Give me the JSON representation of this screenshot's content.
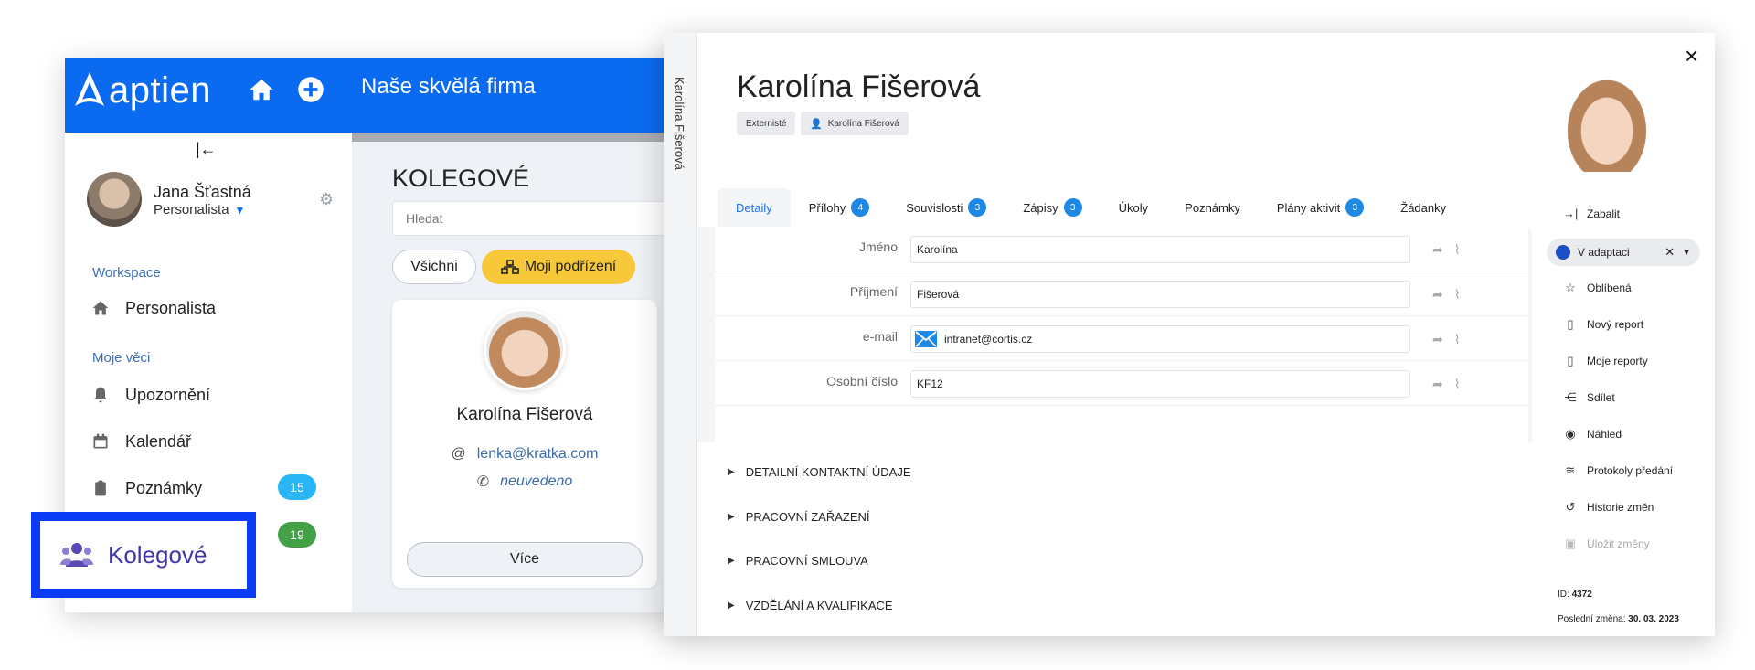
{
  "app": {
    "logo_text": "aptien",
    "company_name": "Naše skvělá firma",
    "brand_color": "#0a6bf0",
    "header_icons": [
      "home-icon",
      "plus-circle-icon"
    ]
  },
  "sidebar": {
    "collapse_glyph": "|←",
    "user": {
      "name": "Jana Šťastná",
      "role": "Personalista"
    },
    "workspace_label": "Workspace",
    "workspace_item": "Personalista",
    "my_things_label": "Moje věci",
    "items": [
      {
        "label": "Upozornění",
        "icon": "bell-icon"
      },
      {
        "label": "Kalendář",
        "icon": "calendar-icon"
      },
      {
        "label": "Poznámky",
        "icon": "clipboard-icon",
        "badge": "15",
        "badge_color": "#29b6f6"
      },
      {
        "label": "Kolegové",
        "icon": "users-icon",
        "badge": "19",
        "badge_color": "#43a047"
      }
    ]
  },
  "content": {
    "title": "KOLEGOVÉ",
    "search_placeholder": "Hledat",
    "filters": {
      "all": "Všichni",
      "mine": "Moji podřízení"
    },
    "card": {
      "name": "Karolína Fišerová",
      "email_prefix": "@",
      "email": "lenka@kratka.com",
      "phone": "neuvedeno",
      "more": "Více"
    }
  },
  "highlight": {
    "label": "Kolegové"
  },
  "detail": {
    "vertical_name": "Karolína Fišerová",
    "title": "Karolína Fišerová",
    "tags": [
      "Externisté",
      "Karolína Fišerová"
    ],
    "close": "×",
    "tabs": [
      {
        "label": "Detaily",
        "active": true
      },
      {
        "label": "Přílohy",
        "count": "4"
      },
      {
        "label": "Souvislosti",
        "count": "3"
      },
      {
        "label": "Zápisy",
        "count": "3"
      },
      {
        "label": "Úkoly"
      },
      {
        "label": "Poznámky"
      },
      {
        "label": "Plány aktivit",
        "count": "3"
      },
      {
        "label": "Žádanky"
      }
    ],
    "fields": [
      {
        "label": "Jméno",
        "value": "Karolína"
      },
      {
        "label": "Příjmení",
        "value": "Fišerová"
      },
      {
        "label": "e-mail",
        "value": "intranet@cortis.cz"
      },
      {
        "label": "Osobní číslo",
        "value": "KF12"
      }
    ],
    "sections": [
      "DETAILNÍ KONTAKTNÍ ÚDAJE",
      "PRACOVNÍ ZAŘAZENÍ",
      "PRACOVNÍ SMLOUVA",
      "VZDĚLÁNÍ A KVALIFIKACE"
    ],
    "actions": {
      "collapse": "Zabalit",
      "status": "V adaptaci",
      "status_color": "#1d4ec2",
      "list": [
        "Oblíbená",
        "Nový report",
        "Moje reporty",
        "Sdílet",
        "Náhled",
        "Protokoly předání",
        "Historie změn",
        "Uložit změny"
      ]
    },
    "meta": {
      "id_label": "ID:",
      "id": "4372",
      "changed_label": "Poslední změna:",
      "changed": "30. 03. 2023"
    }
  }
}
